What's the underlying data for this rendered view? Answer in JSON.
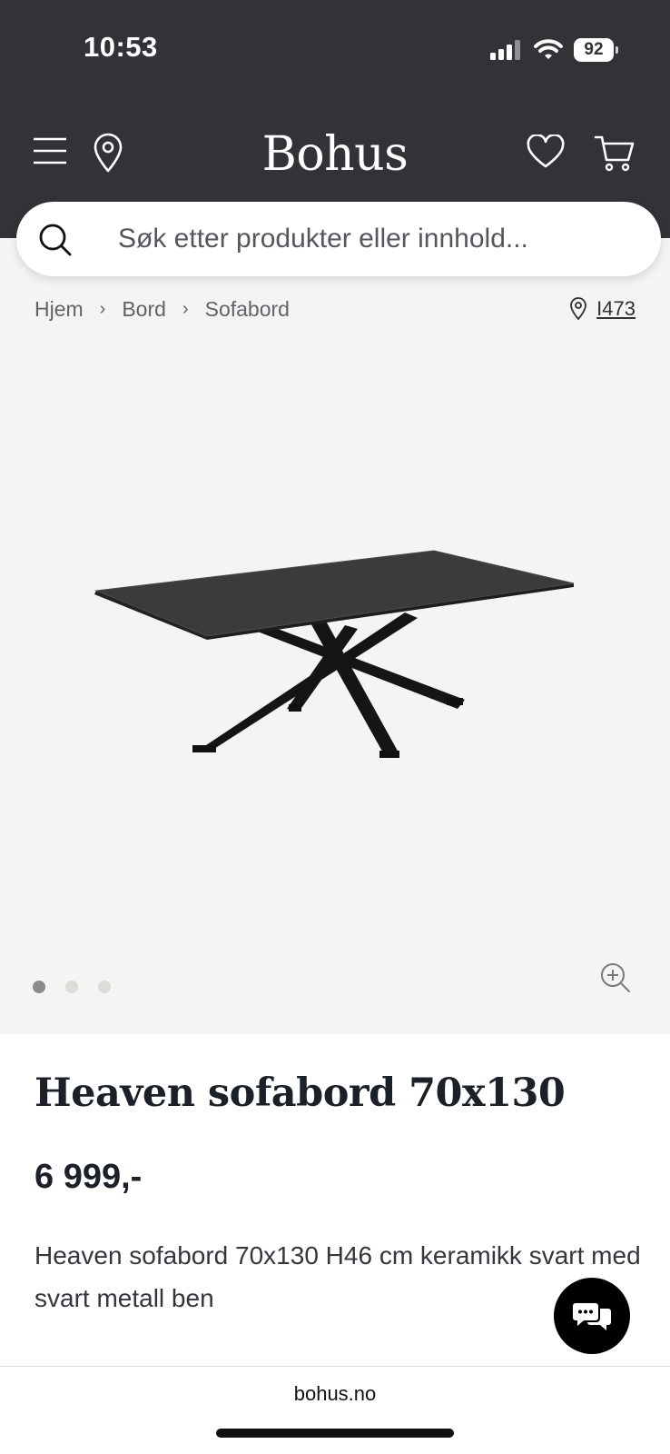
{
  "status_bar": {
    "time": "10:53",
    "battery": "92"
  },
  "header": {
    "logo": "Bohus",
    "icons": [
      "menu-icon",
      "location-pin-icon",
      "heart-icon",
      "cart-icon"
    ]
  },
  "search": {
    "placeholder": "Søk etter produkter eller innhold..."
  },
  "breadcrumb": {
    "items": [
      "Hjem",
      "Bord",
      "Sofabord"
    ]
  },
  "store": {
    "label": "I473"
  },
  "gallery": {
    "image_count": 3,
    "active_index": 0
  },
  "product": {
    "title": "Heaven sofabord 70x130",
    "price": "6 999,-",
    "description": "Heaven sofabord 70x130 H46 cm keramikk svart med svart metall ben"
  },
  "browser": {
    "url": "bohus.no"
  },
  "colors": {
    "header_bg": "#333237",
    "page_bg": "#f5f4f2",
    "text_dark": "#1c2128"
  }
}
